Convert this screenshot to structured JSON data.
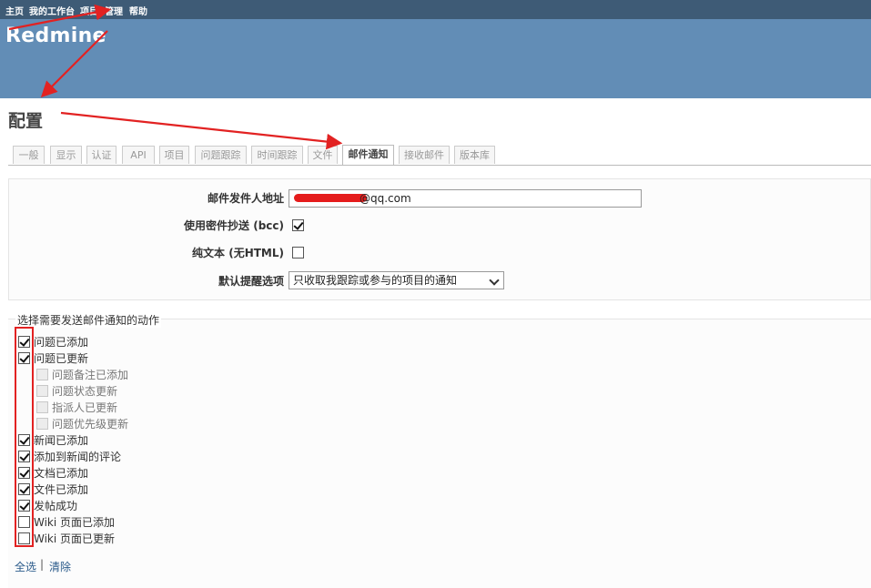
{
  "top_menu": {
    "items": [
      {
        "label": "主页"
      },
      {
        "label": "我的工作台"
      },
      {
        "label": "项目"
      },
      {
        "label": "管理"
      },
      {
        "label": "帮助"
      }
    ]
  },
  "header": {
    "logo": "Redmine"
  },
  "page": {
    "title": "配置"
  },
  "tabs": [
    {
      "label": "一般",
      "selected": false
    },
    {
      "label": "显示",
      "selected": false
    },
    {
      "label": "认证",
      "selected": false
    },
    {
      "label": "API",
      "selected": false
    },
    {
      "label": "项目",
      "selected": false
    },
    {
      "label": "问题跟踪",
      "selected": false
    },
    {
      "label": "时间跟踪",
      "selected": false
    },
    {
      "label": "文件",
      "selected": false
    },
    {
      "label": "邮件通知",
      "selected": true
    },
    {
      "label": "接收邮件",
      "selected": false
    },
    {
      "label": "版本库",
      "selected": false
    }
  ],
  "settings": {
    "mail_from": {
      "label": "邮件发件人地址",
      "value": "@qq.com"
    },
    "bcc": {
      "label": "使用密件抄送 (bcc)",
      "checked": true
    },
    "plain_text": {
      "label": "纯文本 (无HTML)",
      "checked": false
    },
    "default_notification": {
      "label": "默认提醒选项",
      "value": "只收取我跟踪或参与的项目的通知"
    }
  },
  "notify": {
    "legend": "选择需要发送邮件通知的动作",
    "actions": [
      {
        "label": "问题已添加",
        "checked": true,
        "indent": false,
        "disabled": false
      },
      {
        "label": "问题已更新",
        "checked": true,
        "indent": false,
        "disabled": false
      },
      {
        "label": "问题备注已添加",
        "checked": false,
        "indent": true,
        "disabled": true
      },
      {
        "label": "问题状态更新",
        "checked": false,
        "indent": true,
        "disabled": true
      },
      {
        "label": "指派人已更新",
        "checked": false,
        "indent": true,
        "disabled": true
      },
      {
        "label": "问题优先级更新",
        "checked": false,
        "indent": true,
        "disabled": true
      },
      {
        "label": "新闻已添加",
        "checked": true,
        "indent": false,
        "disabled": false
      },
      {
        "label": "添加到新闻的评论",
        "checked": true,
        "indent": false,
        "disabled": false
      },
      {
        "label": "文档已添加",
        "checked": true,
        "indent": false,
        "disabled": false
      },
      {
        "label": "文件已添加",
        "checked": true,
        "indent": false,
        "disabled": false
      },
      {
        "label": "发帖成功",
        "checked": true,
        "indent": false,
        "disabled": false
      },
      {
        "label": "Wiki 页面已添加",
        "checked": false,
        "indent": false,
        "disabled": false
      },
      {
        "label": "Wiki 页面已更新",
        "checked": false,
        "indent": false,
        "disabled": false
      }
    ],
    "select_all": "全选",
    "separator": "|",
    "clear": "清除"
  },
  "annotation_color": "#e22222"
}
